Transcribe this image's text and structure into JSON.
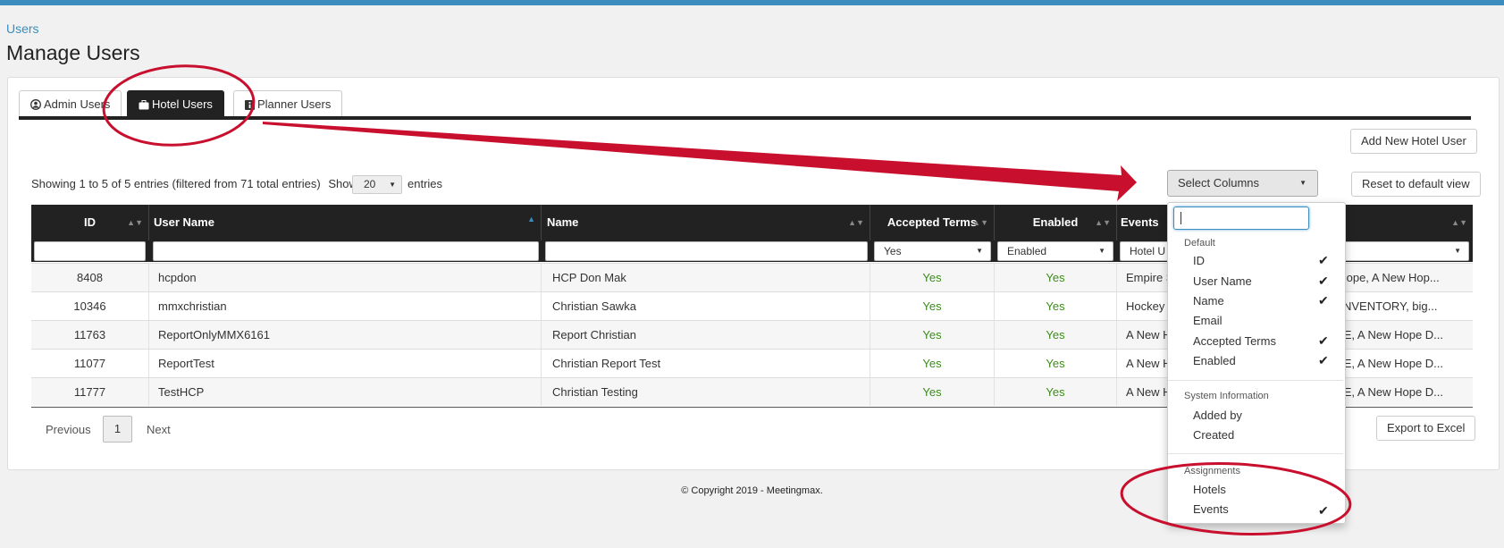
{
  "breadcrumb": "Users",
  "page_title": "Manage Users",
  "tabs": [
    {
      "label": "Admin Users",
      "icon": "user-circle-icon"
    },
    {
      "label": "Hotel Users",
      "icon": "suitcase-icon"
    },
    {
      "label": "Planner Users",
      "icon": "info-box-icon"
    }
  ],
  "toolbar": {
    "add_new": "Add New Hotel User",
    "select_columns": "Select Columns",
    "reset_view": "Reset to default view",
    "export": "Export to Excel"
  },
  "table_info": {
    "showing": "Showing 1 to 5 of 5 entries (filtered from 71 total entries)",
    "show_label": "Show",
    "page_size": "20",
    "entries_label": "entries"
  },
  "columns": [
    "ID",
    "User Name",
    "Name",
    "Accepted Terms",
    "Enabled",
    "Events"
  ],
  "filters": {
    "accepted_terms": "Yes",
    "enabled": "Enabled",
    "events": "Hotel U"
  },
  "rows": [
    {
      "id": "8408",
      "username": "hcpdon",
      "name": "HCP Don Mak",
      "accepted": "Yes",
      "enabled": "Yes",
      "events_left": "Empire S",
      "events_right": "ew Hope, A New Hop..."
    },
    {
      "id": "10346",
      "username": "mmxchristian",
      "name": "Christian Sawka",
      "accepted": "Yes",
      "enabled": "Yes",
      "events_left": "Hockey w",
      "events_right": "CH INVENTORY, big..."
    },
    {
      "id": "11763",
      "username": "ReportOnlyMMX6161",
      "name": "Report Christian",
      "accepted": "Yes",
      "enabled": "Yes",
      "events_left": "A New H",
      "events_right": "be SE, A New Hope D..."
    },
    {
      "id": "11077",
      "username": "ReportTest",
      "name": "Christian Report Test",
      "accepted": "Yes",
      "enabled": "Yes",
      "events_left": "A New H",
      "events_right": "be SE, A New Hope D..."
    },
    {
      "id": "11777",
      "username": "TestHCP",
      "name": "Christian Testing",
      "accepted": "Yes",
      "enabled": "Yes",
      "events_left": "A New H",
      "events_right": "be SE, A New Hope D..."
    }
  ],
  "pagination": {
    "previous": "Previous",
    "current": "1",
    "next": "Next"
  },
  "column_menu": {
    "search_value": "",
    "groups": [
      {
        "heading": "Default",
        "items": [
          {
            "label": "ID",
            "checked": true
          },
          {
            "label": "User Name",
            "checked": true
          },
          {
            "label": "Name",
            "checked": true
          },
          {
            "label": "Email",
            "checked": false
          },
          {
            "label": "Accepted Terms",
            "checked": true
          },
          {
            "label": "Enabled",
            "checked": true
          }
        ]
      },
      {
        "heading": "System Information",
        "items": [
          {
            "label": "Added by",
            "checked": false
          },
          {
            "label": "Created",
            "checked": false
          }
        ]
      },
      {
        "heading": "Assignments",
        "items": [
          {
            "label": "Hotels",
            "checked": false
          },
          {
            "label": "Events",
            "checked": true
          }
        ]
      }
    ]
  },
  "footer": "© Copyright 2019 - Meetingmax.",
  "colors": {
    "accent": "#3b8dbd",
    "header_dark": "#222222",
    "yes_green": "#3c8c1a",
    "annotation_red": "#c8102e"
  }
}
